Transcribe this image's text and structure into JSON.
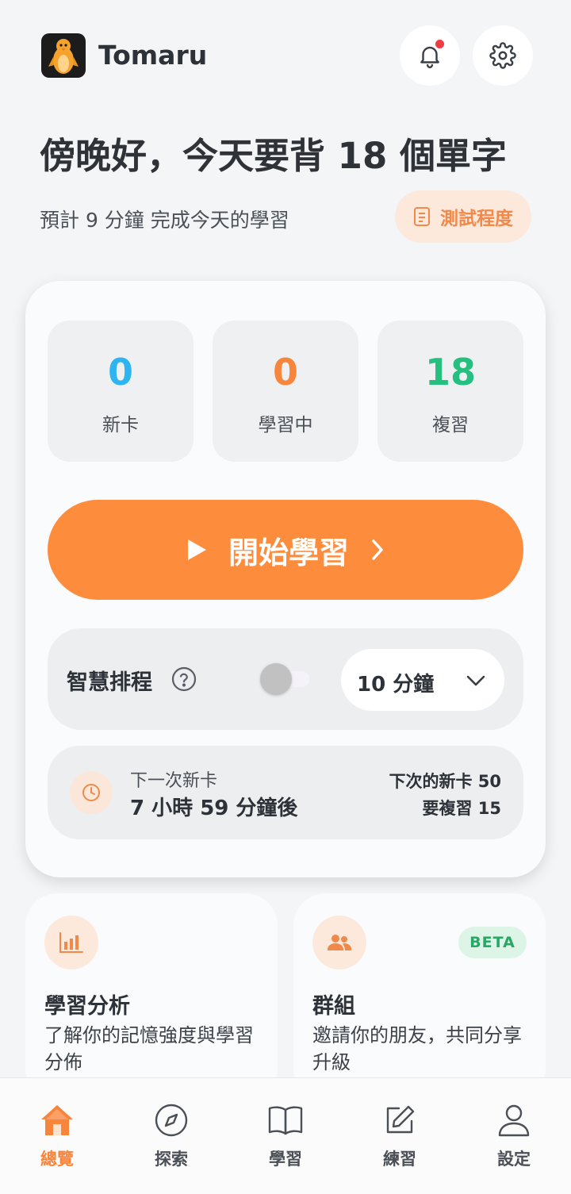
{
  "header": {
    "app_name": "Tomaru",
    "notification_badge": true
  },
  "greeting": "傍晚好，今天要背 18 個單字",
  "subtitle": "預計 9 分鐘 完成今天的學習",
  "test_button": "測試程度",
  "stats": [
    {
      "value": "0",
      "label": "新卡",
      "color": "#2db4f1"
    },
    {
      "value": "0",
      "label": "學習中",
      "color": "#f7853c"
    },
    {
      "value": "18",
      "label": "複習",
      "color": "#25c080"
    }
  ],
  "start_button": "開始學習",
  "smart_schedule": {
    "label": "智慧排程",
    "enabled": false,
    "duration": "10 分鐘"
  },
  "next_card": {
    "title": "下一次新卡",
    "time": "7 小時 59 分鐘後",
    "new_cards": "下次的新卡 50",
    "reviews": "要複習 15"
  },
  "features": [
    {
      "title": "學習分析",
      "desc": "了解你的記憶強度與學習分佈",
      "icon": "bar-chart-icon"
    },
    {
      "title": "群組",
      "desc": "邀請你的朋友，共同分享升級",
      "icon": "group-icon",
      "badge": "BETA"
    }
  ],
  "nav": [
    {
      "label": "總覽",
      "icon": "home-icon",
      "active": true
    },
    {
      "label": "探索",
      "icon": "compass-icon",
      "active": false
    },
    {
      "label": "學習",
      "icon": "book-icon",
      "active": false
    },
    {
      "label": "練習",
      "icon": "edit-icon",
      "active": false
    },
    {
      "label": "設定",
      "icon": "user-icon",
      "active": false
    }
  ],
  "colors": {
    "accent": "#fe8c3d",
    "background": "#f3f5f7",
    "alert": "#ef3b43"
  }
}
